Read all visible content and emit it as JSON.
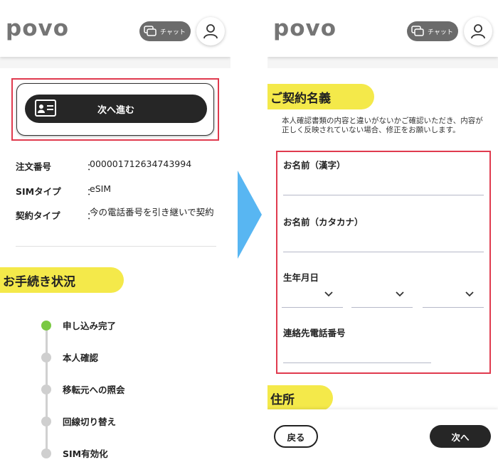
{
  "left": {
    "logo": "povo",
    "chat_label": "チャット",
    "next_button_label": "次へ進む",
    "info": [
      {
        "key": "注文番号",
        "value": "000001712634743994"
      },
      {
        "key": "SIMタイプ",
        "value": "eSIM"
      },
      {
        "key": "契約タイプ",
        "value": "今の電話番号を引き継いで契約"
      }
    ],
    "colon": "：",
    "status_heading": "お手続き状況",
    "timeline": [
      {
        "label": "申し込み完了",
        "done": true
      },
      {
        "label": "本人確認",
        "done": false
      },
      {
        "label": "移転元への照会",
        "done": false
      },
      {
        "label": "回線切り替え",
        "done": false
      },
      {
        "label": "SIM有効化",
        "done": false
      }
    ]
  },
  "right": {
    "logo": "povo",
    "chat_label": "チャット",
    "contract_heading": "ご契約名義",
    "note": "本人確認書類の内容と違いがないかご確認いただき、内容が正しく反映されていない場合、修正をお願いします。",
    "fields": {
      "name_kanji": "お名前（漢字）",
      "name_kana": "お名前（カタカナ）",
      "birthdate": "生年月日",
      "phone": "連絡先電話番号"
    },
    "address_heading": "住所",
    "back_label": "戻る",
    "next_label": "次へ"
  },
  "colors": {
    "accent_yellow": "#f4e94a",
    "highlight_red": "#e03a4e",
    "arrow_blue": "#58b6f2",
    "done_green": "#7ac943",
    "button_dark": "#262626"
  }
}
